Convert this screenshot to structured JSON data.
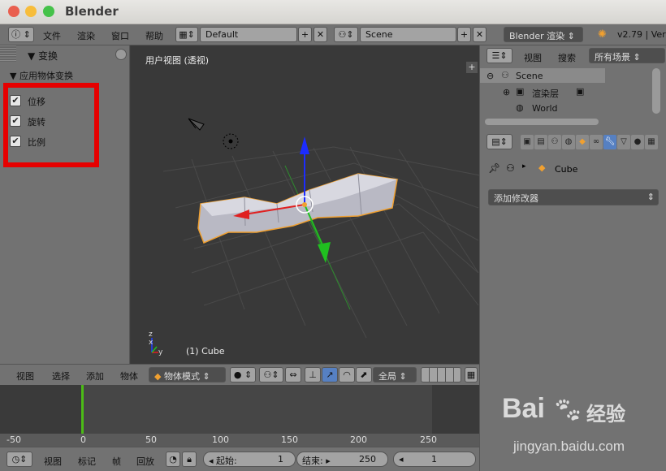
{
  "window": {
    "title": "Blender"
  },
  "info_bar": {
    "menus": [
      "文件",
      "渲染",
      "窗口",
      "帮助"
    ],
    "screen_layout": "Default",
    "scene": "Scene",
    "render_engine": "Blender 渲染",
    "version": "v2.79 | Ver"
  },
  "left_panel": {
    "header": "▼ 变换",
    "subheader": "▼ 应用物体变换",
    "options": [
      {
        "label": "位移",
        "checked": true
      },
      {
        "label": "旋转",
        "checked": true
      },
      {
        "label": "比例",
        "checked": true
      }
    ]
  },
  "viewport": {
    "title": "用户视图 (透视)",
    "object_label": "(1) Cube",
    "axis_x": "x",
    "axis_y": "y",
    "axis_z": "z"
  },
  "viewport_toolbar": {
    "menus": [
      "视图",
      "选择",
      "添加",
      "物体"
    ],
    "mode": "物体模式",
    "orientation": "全局"
  },
  "timeline": {
    "ruler": [
      "-50",
      "0",
      "50",
      "100",
      "150",
      "200",
      "250"
    ],
    "current_frame": 0,
    "menus": [
      "视图",
      "标记",
      "帧",
      "回放"
    ],
    "start_label": "起始:",
    "start_value": "1",
    "end_label": "结束:",
    "end_value": "250",
    "current_value": "1"
  },
  "outliner": {
    "menus": [
      "视图",
      "搜索"
    ],
    "filter": "所有场景",
    "rows": [
      {
        "label": "Scene"
      },
      {
        "label": "渲染层"
      },
      {
        "label": "World"
      }
    ]
  },
  "properties": {
    "object_name": "Cube",
    "add_modifier": "添加修改器"
  },
  "watermark": {
    "brand": "Bai",
    "brand_cn": "经验",
    "url": "jingyan.baidu.com"
  },
  "colors": {
    "accent_orange": "#f0a030",
    "selection_red": "#e60000",
    "axis_red": "#e02020",
    "axis_green": "#20c020",
    "axis_blue": "#2040ff",
    "frame_green": "#4cbb17"
  }
}
